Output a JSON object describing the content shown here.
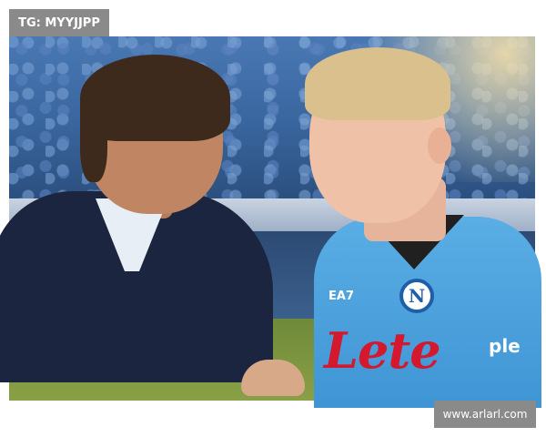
{
  "watermarks": {
    "top_left": "TG: MYYJJPP",
    "bottom_right": "www.arlarl.com"
  },
  "photo": {
    "crest_letter": "N",
    "kit_brand": "EA7",
    "sponsor": "Lete",
    "sleeve_text": "ple"
  }
}
